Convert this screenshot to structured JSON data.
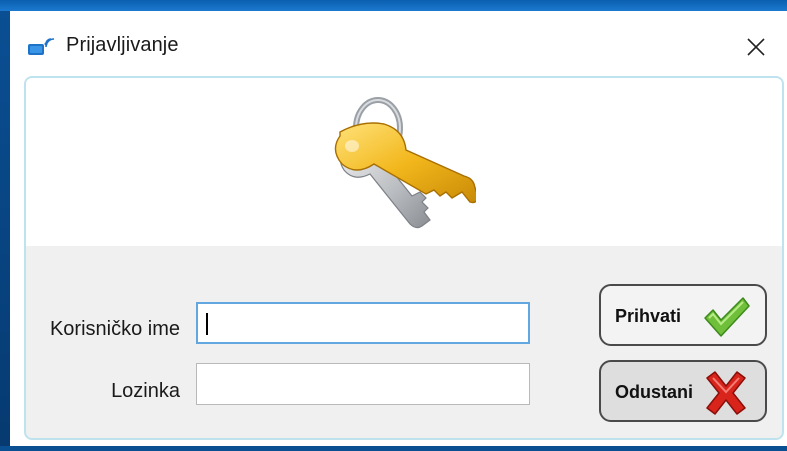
{
  "window": {
    "title": "Prijavljivanje",
    "app_icon": "network-login-icon",
    "close_icon": "close-icon"
  },
  "banner": {
    "icon": "keys-icon"
  },
  "form": {
    "username": {
      "label": "Korisničko ime",
      "value": "",
      "placeholder": ""
    },
    "password": {
      "label": "Lozinka",
      "value": "",
      "placeholder": ""
    }
  },
  "buttons": {
    "accept": {
      "label": "Prihvati",
      "icon": "checkmark-icon"
    },
    "cancel": {
      "label": "Odustani",
      "icon": "cross-icon"
    }
  },
  "colors": {
    "accent": "#62a7e0",
    "panel_border": "#bfe3ee",
    "accept_icon": "#6fbf3a",
    "cancel_icon": "#d9241c"
  }
}
